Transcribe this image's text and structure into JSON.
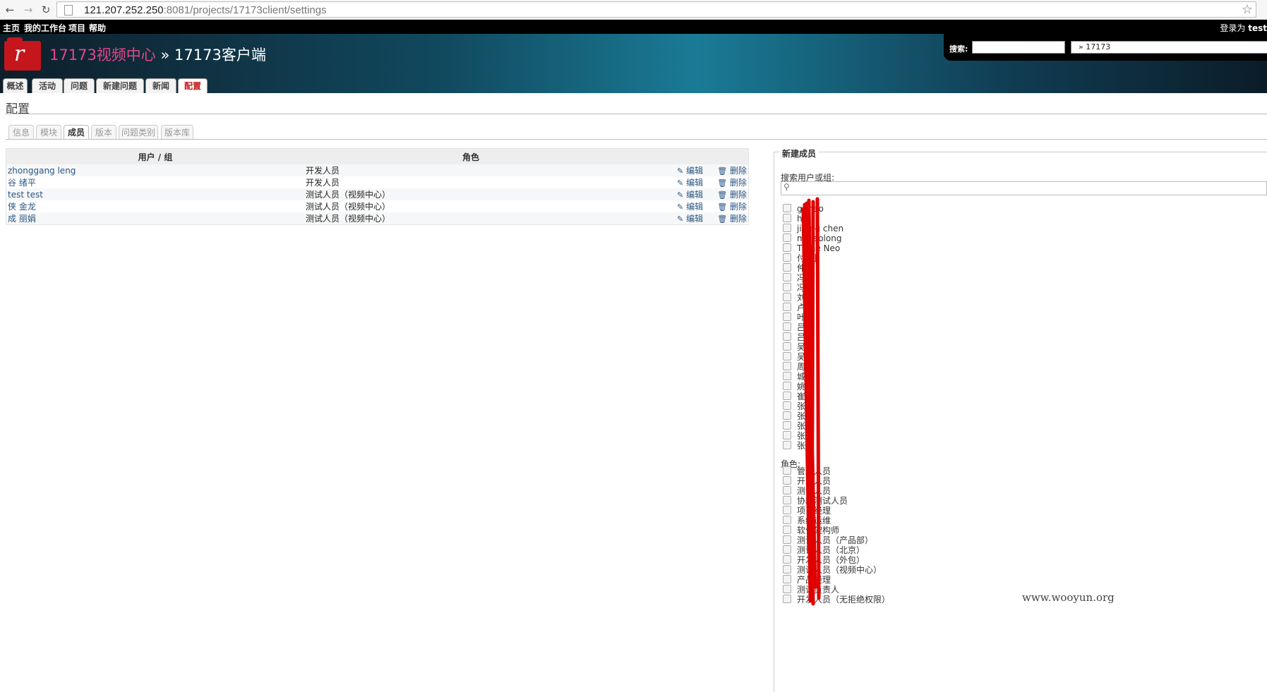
{
  "browser": {
    "url_host": "121.207.252.250",
    "url_rest": ":8081/projects/17173client/settings"
  },
  "top_menu": {
    "items": [
      "主页",
      "我的工作台",
      "项目",
      "帮助"
    ],
    "logged_in_as": "登录为",
    "user": "test"
  },
  "header": {
    "parent_project": "17173视频中心",
    "separator": " » ",
    "project": "17173客户端",
    "search_label": "搜索:",
    "project_jump": "» 17173"
  },
  "main_tabs": [
    {
      "label": "概述",
      "selected": false
    },
    {
      "label": "活动",
      "selected": false
    },
    {
      "label": "问题",
      "selected": false
    },
    {
      "label": "新建问题",
      "selected": false
    },
    {
      "label": "新闻",
      "selected": false
    },
    {
      "label": "配置",
      "selected": true
    }
  ],
  "page_title": "配置",
  "settings_tabs": [
    {
      "label": "信息",
      "selected": false
    },
    {
      "label": "模块",
      "selected": false
    },
    {
      "label": "成员",
      "selected": true
    },
    {
      "label": "版本",
      "selected": false
    },
    {
      "label": "问题类别",
      "selected": false
    },
    {
      "label": "版本库",
      "selected": false
    }
  ],
  "members_table": {
    "col_user": "用户 / 组",
    "col_role": "角色",
    "edit_label": "编辑",
    "delete_label": "删除",
    "rows": [
      {
        "user": "zhonggang leng",
        "role": "开发人员"
      },
      {
        "user": "谷 绪平",
        "role": "开发人员"
      },
      {
        "user": "test test",
        "role": "测试人员（视频中心）"
      },
      {
        "user": "侠 金龙",
        "role": "测试人员（视频中心）"
      },
      {
        "user": "成 丽娟",
        "role": "测试人员（视频中心）"
      }
    ]
  },
  "new_member": {
    "legend": "新建成员",
    "search_label": "搜索用户或组:",
    "principals": [
      "g      mao",
      "h    e",
      "jia    ng chen",
      "ma    aolong",
      "Th    ne Neo",
      "付   刖",
      "仲   ",
      "冯   ",
      "冯    ",
      "刘    ",
      "卢   ",
      "叶    ",
      "吕    ",
      "吕    ",
      "吴    ",
      "吴    ",
      "周    ",
      "城   ",
      "姚    ",
      "崔    ",
      "张    ",
      "张    ",
      "张    ",
      "张    ",
      "张    "
    ],
    "roles_label": "角色:",
    "roles": [
      "管理人员",
      "开发人员",
      "测试人员",
      "协助测试人员",
      "项目经理",
      "系统运维",
      "软件架构师",
      "测试人员（产品部）",
      "测试人员（北京）",
      "开发人员（外包）",
      "测试人员（视频中心）",
      "产品经理",
      "测试负责人",
      "开发人员（无拒绝权限）"
    ]
  },
  "watermark": "www.wooyun.org",
  "colors": {
    "header_dark": "#0e1e2a",
    "header_mid": "#1a7b96",
    "parent_link": "#e34789",
    "selected_tab": "#c61a1a",
    "scribble": "#e00000"
  }
}
